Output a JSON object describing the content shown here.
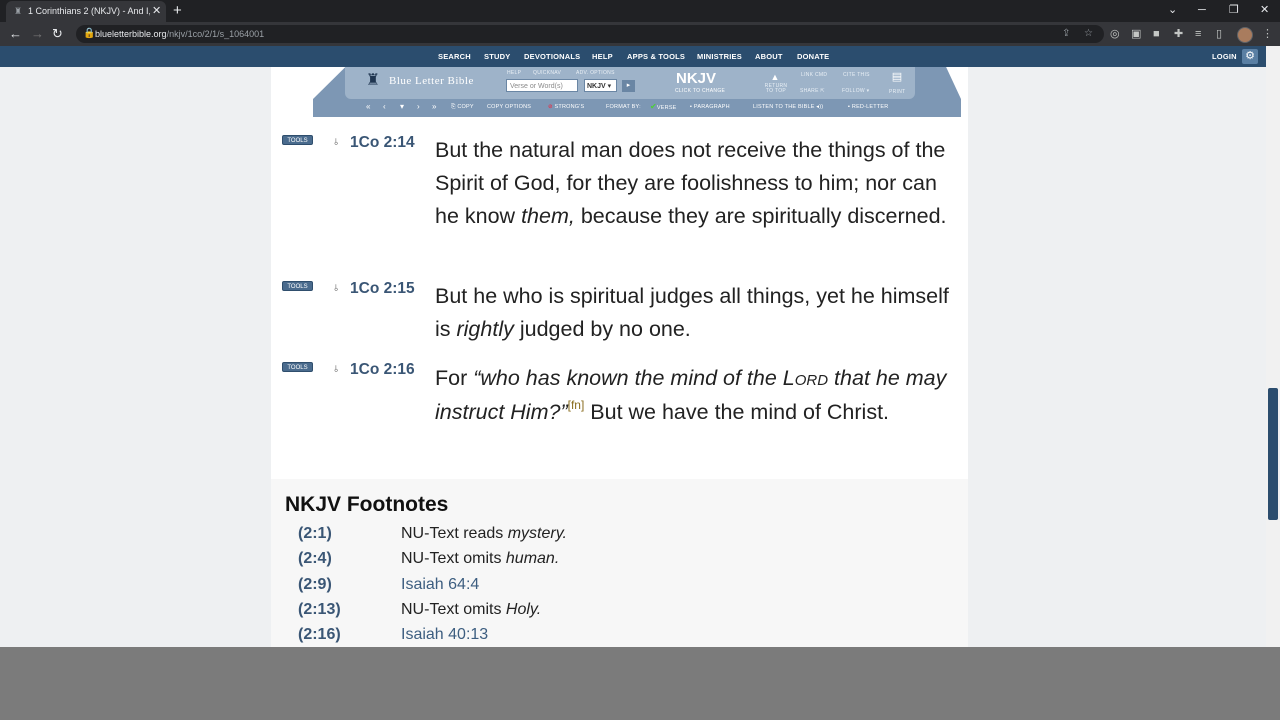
{
  "browser": {
    "tab_title": "1 Corinthians 2 (NKJV) - And I, b",
    "tab_close": "✕",
    "new_tab": "+",
    "url_host": "blueletterbible.org",
    "url_path": "/nkjv/1co/2/1/s_1064001"
  },
  "site_nav": {
    "items": [
      "SEARCH",
      "STUDY",
      "DEVOTIONALS",
      "HELP",
      "APPS & TOOLS",
      "MINISTRIES",
      "ABOUT",
      "DONATE"
    ],
    "login": "LOGIN"
  },
  "toolbar": {
    "logo_text": "Blue Letter Bible",
    "label_help": "HELP",
    "label_quicknav": "QUICKNAV",
    "label_adv_options": "ADV. OPTIONS",
    "verse_placeholder": "Verse or Word(s)",
    "version_select": "NKJV ▾",
    "version_big": "NKJV",
    "version_sub": "CLICK TO CHANGE",
    "return_to_top": "RETURN TO TOP",
    "link_cmd": "LINK CMD",
    "cite_this": "CITE THIS",
    "share": "SHARE ⇱",
    "follow": "FOLLOW ▾",
    "print": "PRINT",
    "copy": "COPY",
    "copy_options": "COPY OPTIONS",
    "strongs": "STRONG'S",
    "format_by": "FORMAT BY:",
    "verse": "VERSE",
    "paragraph": "PARAGRAPH",
    "listen": "LISTEN TO THE BIBLE",
    "red_letter": "RED-LETTER"
  },
  "verses": [
    {
      "tools": "TOOLS",
      "ref": "1Co 2:14",
      "text_a": "But the natural man does not receive the things of the Spirit of God, for they are foolishness to him; nor can he know ",
      "text_italic": "them,",
      "text_b": " because they are spiritually discerned."
    },
    {
      "tools": "TOOLS",
      "ref": "1Co 2:15",
      "text_a": "But he who is spiritual judges all things, yet he himself is ",
      "text_italic": "rightly",
      "text_b": " judged by no one."
    },
    {
      "tools": "TOOLS",
      "ref": "1Co 2:16",
      "text_a": "For ",
      "text_italic_a": "“who has known the mind of the ",
      "lord": "Lord",
      "text_italic_b": " that he may instruct Him?”",
      "fn": "[fn]",
      "text_b": " But we have the mind of Christ."
    }
  ],
  "footnotes": {
    "heading": "NKJV Footnotes",
    "items": [
      {
        "ref": "(2:1)",
        "text": "NU-Text reads ",
        "italic": "mystery."
      },
      {
        "ref": "(2:4)",
        "text": "NU-Text omits ",
        "italic": "human."
      },
      {
        "ref": "(2:9)",
        "link": "Isaiah 64:4"
      },
      {
        "ref": "(2:13)",
        "text": "NU-Text omits ",
        "italic": "Holy."
      },
      {
        "ref": "(2:16)",
        "link": "Isaiah 40:13"
      }
    ]
  }
}
